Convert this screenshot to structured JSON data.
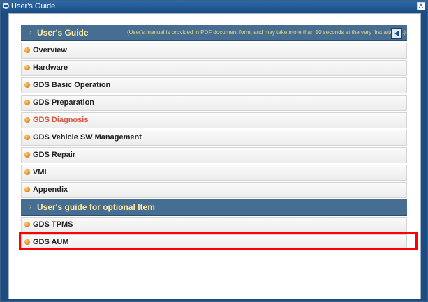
{
  "window": {
    "title": "User's Guide",
    "close_label": "X"
  },
  "header1": {
    "title": "User's Guide",
    "note": "(User's manual is provided in PDF document form, and may take more than 10 seconds at the very first attempt.)"
  },
  "items_main": [
    {
      "label": "Overview"
    },
    {
      "label": "Hardware"
    },
    {
      "label": "GDS Basic Operation"
    },
    {
      "label": "GDS Preparation"
    },
    {
      "label": "GDS Diagnosis",
      "active": true
    },
    {
      "label": "GDS Vehicle SW Management"
    },
    {
      "label": "GDS Repair"
    },
    {
      "label": "VMI"
    },
    {
      "label": "Appendix"
    }
  ],
  "header2": {
    "title": "User's guide for optional Item"
  },
  "items_optional": [
    {
      "label": "GDS TPMS"
    },
    {
      "label": "GDS AUM",
      "highlighted": true
    }
  ],
  "colors": {
    "header_bg": "#466e92",
    "active_text": "#d4503c",
    "highlight": "#ff0000"
  }
}
